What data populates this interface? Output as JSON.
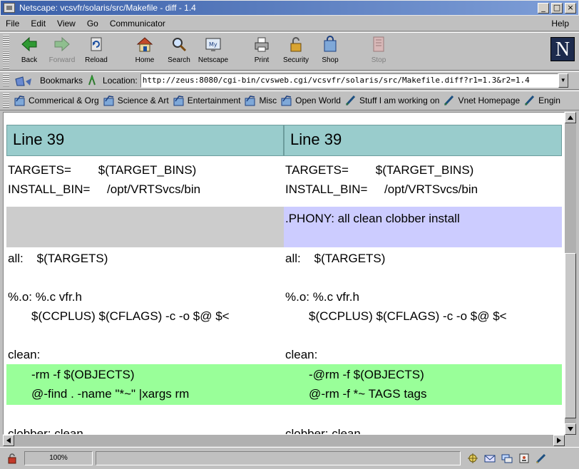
{
  "window": {
    "title": "Netscape: vcsvfr/solaris/src/Makefile - diff - 1.4",
    "minimize": "_",
    "maximize": "□",
    "close": "×"
  },
  "menu": {
    "file": "File",
    "edit": "Edit",
    "view": "View",
    "go": "Go",
    "communicator": "Communicator",
    "help": "Help"
  },
  "toolbar": {
    "back": "Back",
    "forward": "Forward",
    "reload": "Reload",
    "home": "Home",
    "search": "Search",
    "netscape": "Netscape",
    "print": "Print",
    "security": "Security",
    "shop": "Shop",
    "stop": "Stop",
    "logo": "N"
  },
  "location": {
    "bookmarks_label": "Bookmarks",
    "location_label": "Location:",
    "url": "http://zeus:8080/cgi-bin/cvsweb.cgi/vcsvfr/solaris/src/Makefile.diff?r1=1.3&r2=1.4"
  },
  "personal_toolbar": {
    "items": [
      "Commerical & Org",
      "Science & Art",
      "Entertainment",
      "Misc",
      "Open World",
      "Stuff I am working on",
      "Vnet Homepage",
      "Engin"
    ]
  },
  "diff": {
    "left": {
      "header": "Line 39",
      "l1": "TARGETS=        $(TARGET_BINS)",
      "l2": "INSTALL_BIN=     /opt/VRTSvcs/bin",
      "l3": "all:    $(TARGETS)",
      "l4": "%.o: %.c vfr.h",
      "l5": "       $(CCPLUS) $(CFLAGS) -c -o $@ $<",
      "l6": "clean:",
      "l7": "       -rm -f $(OBJECTS)",
      "l8": "       @-find . -name \"*~\" |xargs rm",
      "l9": "clobber: clean"
    },
    "right": {
      "header": "Line 39",
      "l1": "TARGETS=        $(TARGET_BINS)",
      "l2": "INSTALL_BIN=     /opt/VRTSvcs/bin",
      "added": ".PHONY: all clean clobber install",
      "l3": "all:    $(TARGETS)",
      "l4": "%.o: %.c vfr.h",
      "l5": "       $(CCPLUS) $(CFLAGS) -c -o $@ $<",
      "l6": "clean:",
      "l7": "       -@rm -f $(OBJECTS)",
      "l8": "       @-rm -f *~ TAGS tags",
      "l9": "clobber: clean"
    }
  },
  "status": {
    "zoom": "100%",
    "message": ""
  }
}
